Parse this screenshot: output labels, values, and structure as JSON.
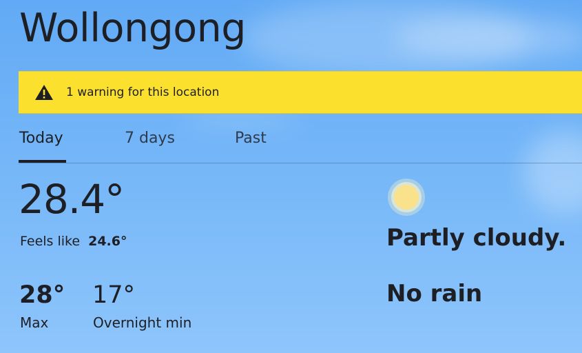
{
  "location": {
    "title": "Wollongong"
  },
  "warning": {
    "text": "1 warning for this location",
    "icon": "warning-triangle-icon",
    "color": "#fbe02e"
  },
  "tabs": [
    {
      "label": "Today",
      "active": true
    },
    {
      "label": "7 days",
      "active": false
    },
    {
      "label": "Past",
      "active": false
    }
  ],
  "today": {
    "current_temp": "28.4°",
    "feels_like_label": "Feels like",
    "feels_like_value": "24.6°",
    "max_temp": "28°",
    "max_label": "Max",
    "min_temp": "17°",
    "min_label": "Overnight min",
    "condition_icon": "sun-icon",
    "condition": "Partly cloudy.",
    "rain": "No rain"
  },
  "colors": {
    "sky_top": "#62aaf5",
    "sky_bottom": "#8ec5fb",
    "text": "#1d1f24",
    "sun": "#f9e28b"
  }
}
